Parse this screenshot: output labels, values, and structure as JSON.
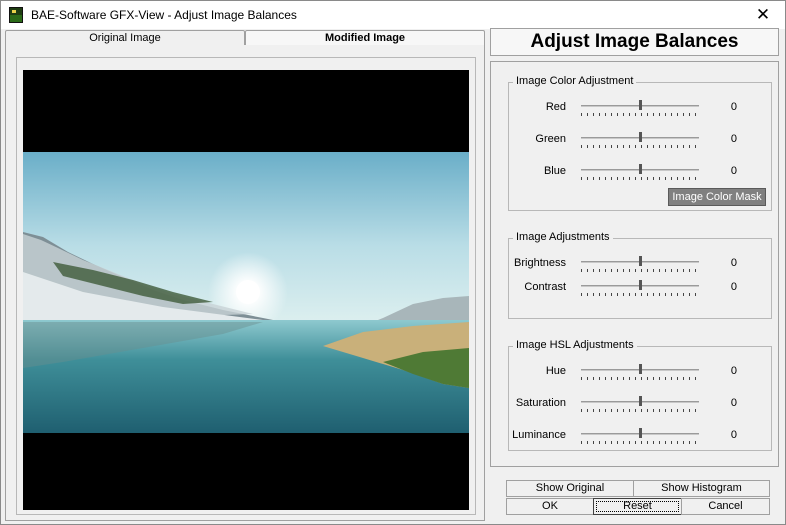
{
  "window": {
    "title": "BAE-Software GFX-View - Adjust Image Balances",
    "close_glyph": "✕"
  },
  "tabs": [
    {
      "label": "Original Image",
      "active": false
    },
    {
      "label": "Modified Image",
      "active": true
    }
  ],
  "panel": {
    "header": "Adjust Image Balances",
    "groups": {
      "color": {
        "title": "Image Color Adjustment",
        "rows": [
          {
            "label": "Red",
            "value": "0",
            "level": 0.5
          },
          {
            "label": "Green",
            "value": "0",
            "level": 0.5
          },
          {
            "label": "Blue",
            "value": "0",
            "level": 0.5
          }
        ],
        "mask_button": "Image Color Mask"
      },
      "adjust": {
        "title": "Image Adjustments",
        "rows": [
          {
            "label": "Brightness",
            "value": "0",
            "level": 0.5
          },
          {
            "label": "Contrast",
            "value": "0",
            "level": 0.5
          }
        ]
      },
      "hsl": {
        "title": "Image HSL Adjustments",
        "rows": [
          {
            "label": "Hue",
            "value": "0",
            "level": 0.5
          },
          {
            "label": "Saturation",
            "value": "0",
            "level": 0.5
          },
          {
            "label": "Luminance",
            "value": "0",
            "level": 0.5
          }
        ]
      }
    }
  },
  "buttons": {
    "show_original": "Show Original",
    "show_histogram": "Show Histogram",
    "ok": "OK",
    "reset": "Reset",
    "cancel": "Cancel"
  },
  "colors": {
    "mask_button_bg": "#808080",
    "slider_thumb": "#555555"
  },
  "icons": {
    "app": "app-icon",
    "close": "close-icon"
  }
}
